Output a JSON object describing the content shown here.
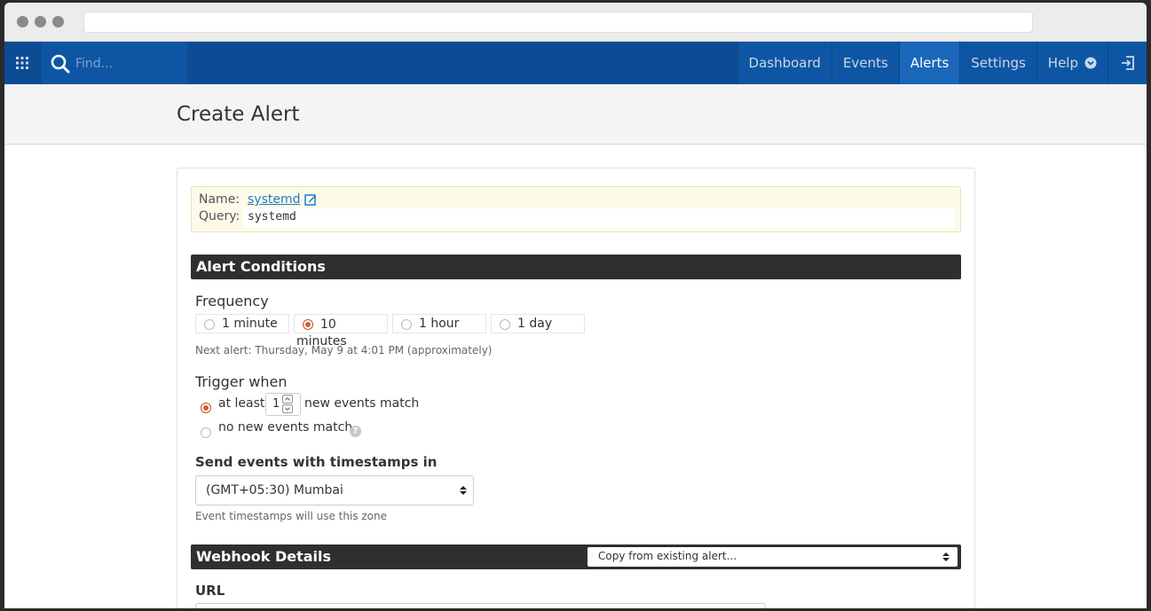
{
  "nav": {
    "search_placeholder": "Find...",
    "items": [
      "Dashboard",
      "Events",
      "Alerts",
      "Settings",
      "Help"
    ],
    "active": "Alerts"
  },
  "page": {
    "title": "Create Alert"
  },
  "alert": {
    "name_label": "Name:",
    "name_value": "systemd",
    "query_label": "Query:",
    "query_value": "systemd"
  },
  "conditions": {
    "section_title": "Alert Conditions",
    "frequency_label": "Frequency",
    "frequency_options": [
      "1 minute",
      "10 minutes",
      "1 hour",
      "1 day"
    ],
    "frequency_selected": "10 minutes",
    "next_alert_hint": "Next alert: Thursday, May 9 at 4:01 PM (approximately)",
    "trigger_label": "Trigger when",
    "trigger_at_least": "at least",
    "trigger_count": "1",
    "trigger_new_events": "new events match",
    "trigger_no_new": "no new events match",
    "trigger_selected": "at least",
    "timestamps_label": "Send events with timestamps in",
    "timezone_value": "(GMT+05:30) Mumbai",
    "timezone_hint": "Event timestamps will use this zone"
  },
  "webhook": {
    "section_title": "Webhook Details",
    "copy_placeholder": "Copy from existing alert...",
    "url_label": "URL"
  },
  "colors": {
    "nav_bg": "#0d4c94",
    "nav_active": "#1a67b9",
    "section_bar": "#2f2f2f",
    "radio_on": "#d35e30",
    "link": "#1a7bd1"
  }
}
